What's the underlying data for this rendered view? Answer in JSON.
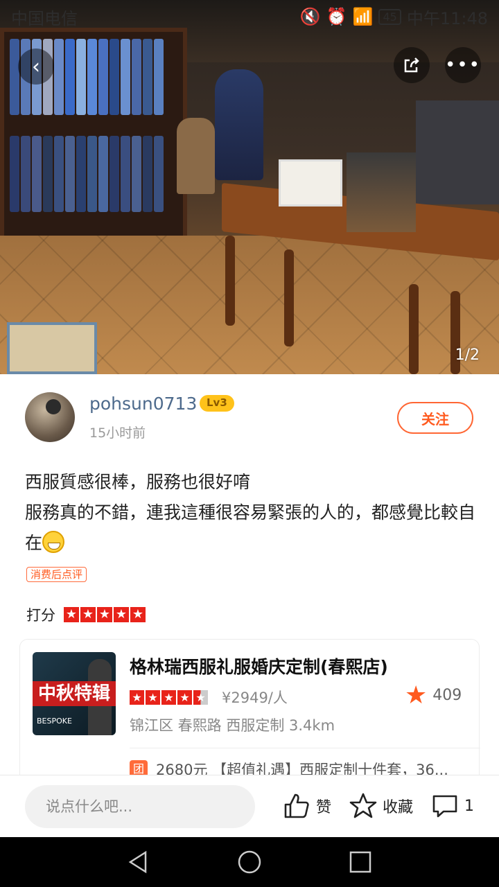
{
  "status_bar": {
    "carrier": "中国电信",
    "battery": "45",
    "time": "中午11:48"
  },
  "gallery": {
    "counter": "1/2"
  },
  "author": {
    "username": "pohsun0713",
    "level": "Lv3",
    "time": "15小时前",
    "follow_label": "关注"
  },
  "review": {
    "line1": "西服質感很棒，服務也很好唷",
    "line2": "服務真的不錯，連我這種很容易緊張的人的，都感覺比較自在",
    "tag": "消费后点评",
    "rating_label": "打分",
    "rating": 5
  },
  "shop": {
    "name": "格林瑞西服礼服婚庆定制(春熙店)",
    "thumb_text": "中秋特辑",
    "thumb_sub": "BESPOKE",
    "rating": 4.5,
    "price": "¥2949/人",
    "favorites": "409",
    "location": "锦江区 春熙路 西服定制 3.4km",
    "deal_icon": "团",
    "deal_text": "2680元 【超值礼遇】西服定制十件套，36..."
  },
  "bottom_bar": {
    "input_placeholder": "说点什么吧...",
    "like_label": "赞",
    "collect_label": "收藏",
    "comment_count": "1"
  },
  "colors": {
    "accent": "#ff5a1f",
    "star": "#e8231a",
    "level": "#ffc21a",
    "username": "#4d6a8c"
  }
}
